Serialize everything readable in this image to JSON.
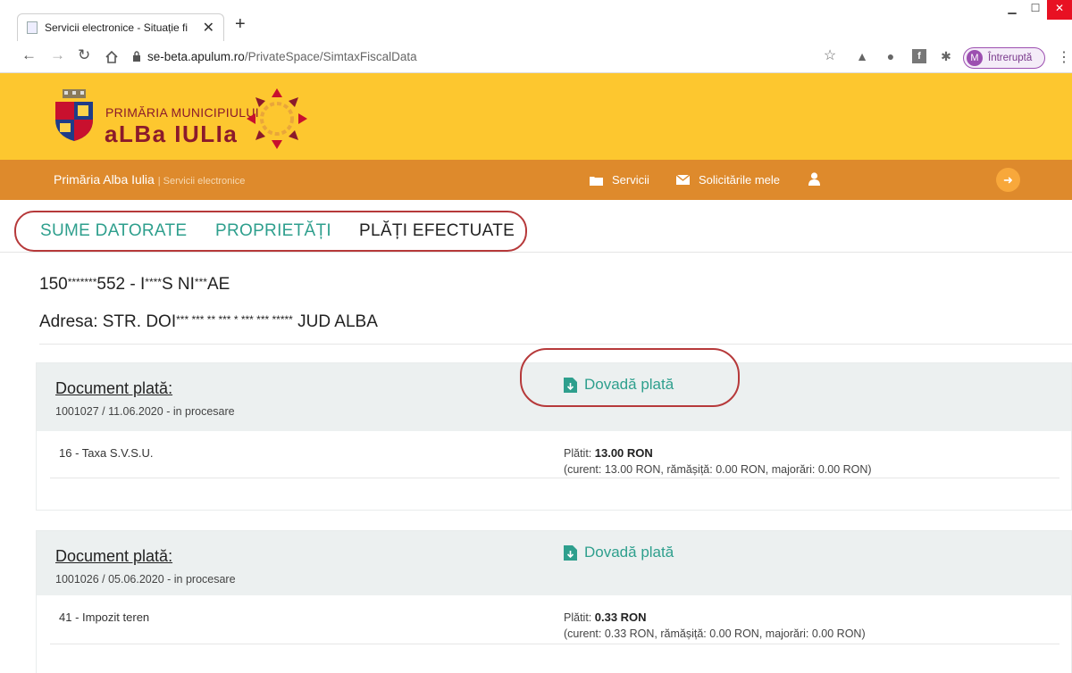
{
  "browser": {
    "tab_title": "Servicii electronice - Situație fisca",
    "tab_close": "✕",
    "new_tab": "+",
    "url_host": "se-beta.apulum.ro",
    "url_path": "/PrivateSpace/SimtaxFiscalData",
    "profile_initial": "M",
    "profile_label": "Întreruptă",
    "icons": [
      "star-icon",
      "drive-icon",
      "extension-icon",
      "facebook-icon",
      "puzzle-icon"
    ]
  },
  "site": {
    "brand_top": "PRIMĂRIA MUNICIPIULUI",
    "brand_main": "aLBa IULIa",
    "nav_brand": "Primăria Alba Iulia",
    "nav_brand_sub": "| Servicii electronice",
    "nav_services": "Servicii",
    "nav_requests": "Solicitările mele",
    "colors": {
      "header": "#fdc72f",
      "nav": "#de8a2c",
      "accent": "#2e9f8d",
      "highlight": "#b6393a"
    }
  },
  "tabs": [
    "SUME DATORATE",
    "PROPRIETĂȚI",
    "PLĂȚI EFECTUATE"
  ],
  "taxpayer": {
    "id_prefix": "150",
    "id_stars": "*******",
    "id_mid": "552 - I",
    "id_stars2": "****",
    "id_mid2": "S NI",
    "id_stars3": "***",
    "id_end": "AE",
    "address_prefix": "Adresa: STR. DOI",
    "address_stars": "*** *** ** *** * *** *** *****",
    "address_end": " JUD ALBA"
  },
  "payments": [
    {
      "doc_label": "Document plată:",
      "doc_meta": "1001027 / 11.06.2020 - in procesare",
      "proof_label": "Dovadă plată",
      "line_name": "16 - Taxa S.V.S.U.",
      "paid_label": "Plătit:",
      "paid_amount": "13.00 RON",
      "detail": "(curent: 13.00 RON, rămășiță: 0.00 RON, majorări: 0.00 RON)"
    },
    {
      "doc_label": "Document plată:",
      "doc_meta": "1001026 / 05.06.2020 - in procesare",
      "proof_label": "Dovadă plată",
      "line_name": "41 - Impozit teren",
      "paid_label": "Plătit:",
      "paid_amount": "0.33 RON",
      "detail": "(curent: 0.33 RON, rămășiță: 0.00 RON, majorări: 0.00 RON)"
    }
  ]
}
